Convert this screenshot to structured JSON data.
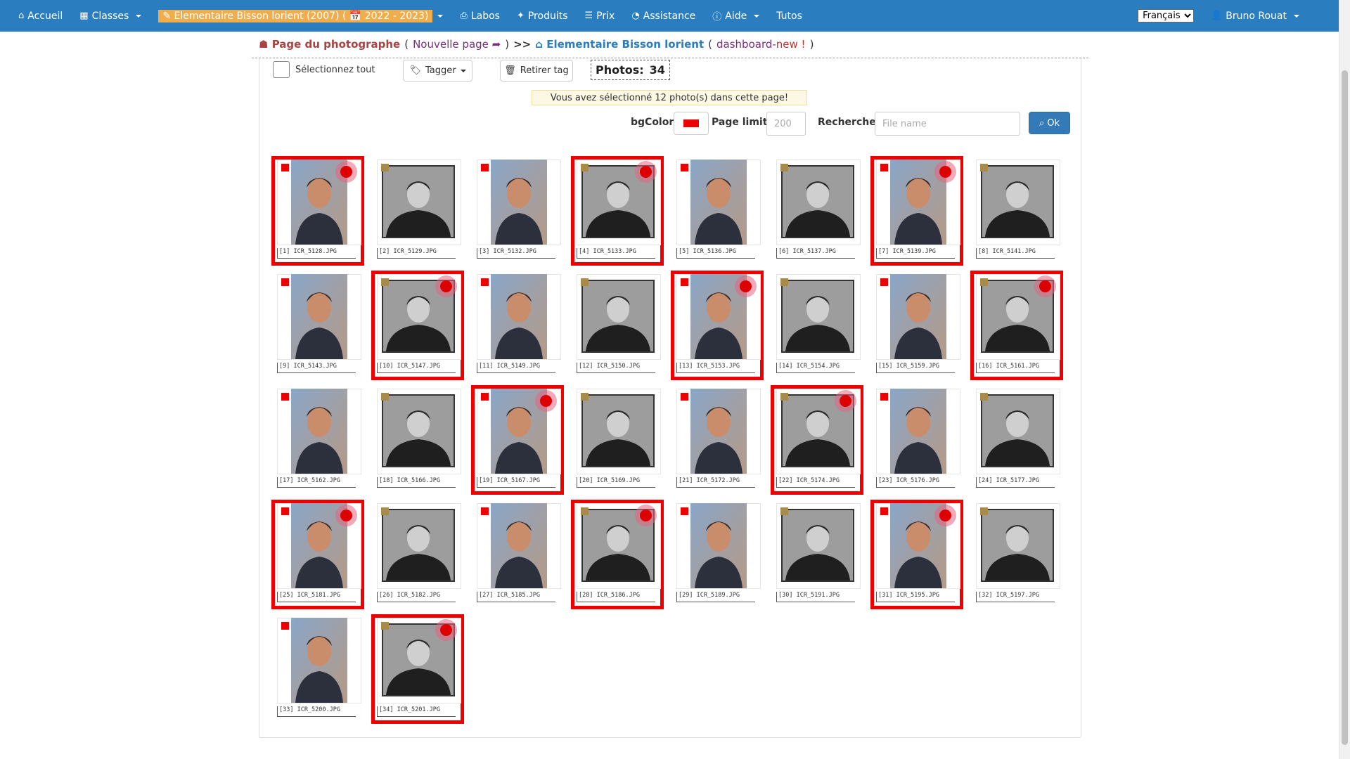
{
  "nav": {
    "home": "Accueil",
    "classes": "Classes",
    "school": "Elementaire Bisson lorient (2007) ( 📅 2022 - 2023)",
    "labos": "Labos",
    "produits": "Produits",
    "prix": "Prix",
    "assistance": "Assistance",
    "aide": "Aide",
    "tutos": "Tutos",
    "language": "Français",
    "user": "Bruno Rouat"
  },
  "breadcrumb": {
    "page": "Page du photographe",
    "open_paren": "(",
    "new_page": "Nouvelle page",
    "close_paren": ")",
    "separator": ">>",
    "school": "Elementaire Bisson lorient",
    "dash_open": "(",
    "dashboard": "dashboard-",
    "new_flag": "new !",
    "dash_close": ")"
  },
  "toolbar": {
    "select_all": "Sélectionnez tout",
    "tag_button": "Tagger",
    "remove_tag_button": "Retirer tag",
    "photos_label": "Photos:",
    "photos_count": "34"
  },
  "alert": "Vous avez sélectionné 12 photo(s) dans cette page!",
  "controls": {
    "bgcolor_label": "bgColor",
    "bgcolor_value": "#ee0000",
    "page_limit_label": "Page limit",
    "page_limit_placeholder": "200",
    "search_label": "Recherche",
    "search_placeholder": "File name",
    "ok_button": "Ok"
  },
  "colors": {
    "nav_bg": "#2a7dbf",
    "selected_border": "#ee0000",
    "tag_red": "#ee0000",
    "tag_gold": "#a88a4a"
  },
  "photos": [
    {
      "label": "[1] ICR_5128.JPG",
      "style": "color",
      "selected": true
    },
    {
      "label": "[2] ICR_5129.JPG",
      "style": "bw",
      "selected": false
    },
    {
      "label": "[3] ICR_5132.JPG",
      "style": "color",
      "selected": false
    },
    {
      "label": "[4] ICR_5133.JPG",
      "style": "bw",
      "selected": true
    },
    {
      "label": "[5] ICR_5136.JPG",
      "style": "color",
      "selected": false
    },
    {
      "label": "[6] ICR_5137.JPG",
      "style": "bw",
      "selected": false
    },
    {
      "label": "[7] ICR_5139.JPG",
      "style": "color",
      "selected": true
    },
    {
      "label": "[8] ICR_5141.JPG",
      "style": "bw",
      "selected": false
    },
    {
      "label": "[9] ICR_5143.JPG",
      "style": "color",
      "selected": false
    },
    {
      "label": "[10] ICR_5147.JPG",
      "style": "bw",
      "selected": true
    },
    {
      "label": "[11] ICR_5149.JPG",
      "style": "color",
      "selected": false
    },
    {
      "label": "[12] ICR_5150.JPG",
      "style": "bw",
      "selected": false
    },
    {
      "label": "[13] ICR_5153.JPG",
      "style": "color",
      "selected": true
    },
    {
      "label": "[14] ICR_5154.JPG",
      "style": "bw",
      "selected": false
    },
    {
      "label": "[15] ICR_5159.JPG",
      "style": "color",
      "selected": false
    },
    {
      "label": "[16] ICR_5161.JPG",
      "style": "bw",
      "selected": true
    },
    {
      "label": "[17] ICR_5162.JPG",
      "style": "color",
      "selected": false
    },
    {
      "label": "[18] ICR_5166.JPG",
      "style": "bw",
      "selected": false
    },
    {
      "label": "[19] ICR_5167.JPG",
      "style": "color",
      "selected": true
    },
    {
      "label": "[20] ICR_5169.JPG",
      "style": "bw",
      "selected": false
    },
    {
      "label": "[21] ICR_5172.JPG",
      "style": "color",
      "selected": false
    },
    {
      "label": "[22] ICR_5174.JPG",
      "style": "bw",
      "selected": true
    },
    {
      "label": "[23] ICR_5176.JPG",
      "style": "color",
      "selected": false
    },
    {
      "label": "[24] ICR_5177.JPG",
      "style": "bw",
      "selected": false
    },
    {
      "label": "[25] ICR_5181.JPG",
      "style": "color",
      "selected": true
    },
    {
      "label": "[26] ICR_5182.JPG",
      "style": "bw",
      "selected": false
    },
    {
      "label": "[27] ICR_5185.JPG",
      "style": "color",
      "selected": false
    },
    {
      "label": "[28] ICR_5186.JPG",
      "style": "bw",
      "selected": true
    },
    {
      "label": "[29] ICR_5189.JPG",
      "style": "color",
      "selected": false
    },
    {
      "label": "[30] ICR_5191.JPG",
      "style": "bw",
      "selected": false
    },
    {
      "label": "[31] ICR_5195.JPG",
      "style": "color",
      "selected": true
    },
    {
      "label": "[32] ICR_5197.JPG",
      "style": "bw",
      "selected": false
    },
    {
      "label": "[33] ICR_5200.JPG",
      "style": "color",
      "selected": false
    },
    {
      "label": "[34] ICR_5201.JPG",
      "style": "bw",
      "selected": true
    }
  ]
}
